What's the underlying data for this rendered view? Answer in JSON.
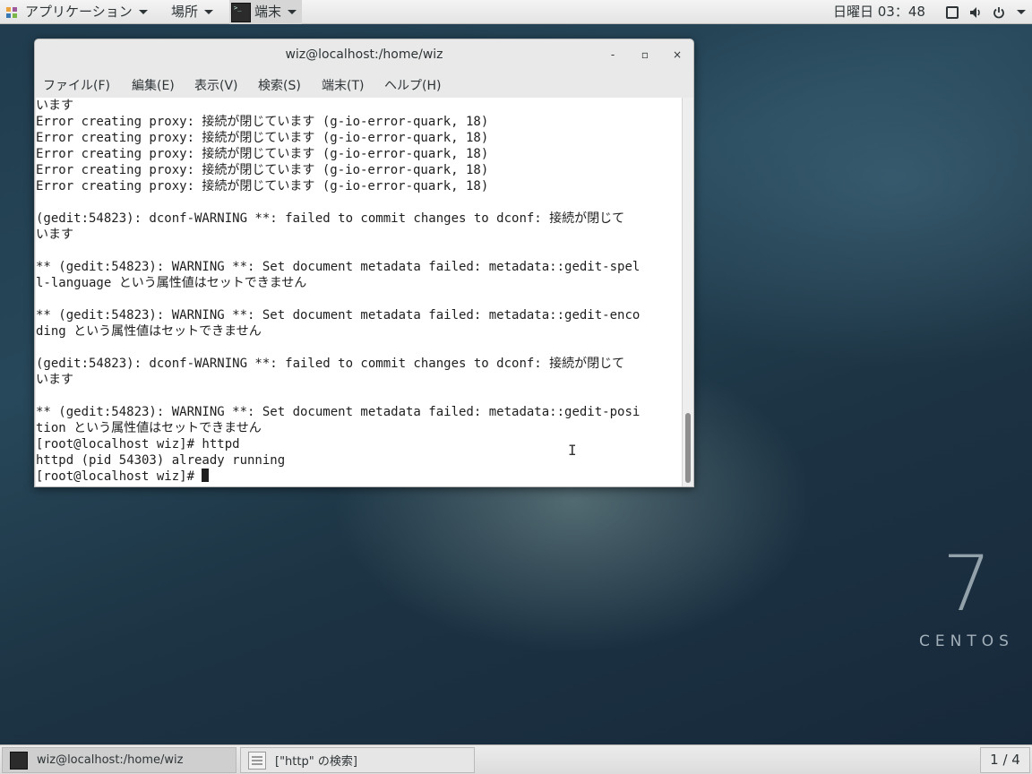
{
  "topbar": {
    "applications": "アプリケーション",
    "places": "場所",
    "terminal_app": "端末",
    "clock": "日曜日 03：48"
  },
  "window": {
    "title": "wiz@localhost:/home/wiz",
    "minimize": "-",
    "maximize": "▫",
    "close": "×",
    "menu": [
      "ファイル(F)",
      "編集(E)",
      "表示(V)",
      "検索(S)",
      "端末(T)",
      "ヘルプ(H)"
    ]
  },
  "terminal": {
    "lines": [
      "います",
      "Error creating proxy: 接続が閉じています (g-io-error-quark, 18)",
      "Error creating proxy: 接続が閉じています (g-io-error-quark, 18)",
      "Error creating proxy: 接続が閉じています (g-io-error-quark, 18)",
      "Error creating proxy: 接続が閉じています (g-io-error-quark, 18)",
      "Error creating proxy: 接続が閉じています (g-io-error-quark, 18)",
      "",
      "(gedit:54823): dconf-WARNING **: failed to commit changes to dconf: 接続が閉じて",
      "います",
      "",
      "** (gedit:54823): WARNING **: Set document metadata failed: metadata::gedit-spel",
      "l-language という属性値はセットできません",
      "",
      "** (gedit:54823): WARNING **: Set document metadata failed: metadata::gedit-enco",
      "ding という属性値はセットできません",
      "",
      "(gedit:54823): dconf-WARNING **: failed to commit changes to dconf: 接続が閉じて",
      "います",
      "",
      "** (gedit:54823): WARNING **: Set document metadata failed: metadata::gedit-posi",
      "tion という属性値はセットできません",
      "[root@localhost wiz]# httpd",
      "httpd (pid 54303) already running",
      "[root@localhost wiz]# "
    ]
  },
  "desktop": {
    "brand_number": "7",
    "brand_text": "CENTOS"
  },
  "taskbar": {
    "tasks": [
      "wiz@localhost:/home/wiz",
      "[\"http\" の検索]"
    ],
    "workspace": "1 / 4"
  }
}
